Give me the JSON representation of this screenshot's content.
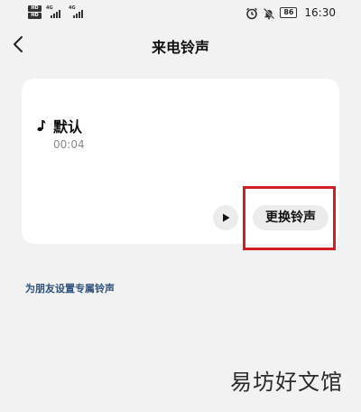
{
  "status_bar": {
    "hd_badges": [
      "HD",
      "HD"
    ],
    "network_labels": [
      "4G",
      "4G"
    ],
    "battery_level": "86",
    "time": "16:30",
    "icons": [
      "alarm-icon",
      "mute-icon"
    ]
  },
  "header": {
    "title": "来电铃声",
    "back_icon": "chevron-left-icon"
  },
  "ringtone_card": {
    "name": "默认",
    "duration": "00:04",
    "note_icon": "music-note-icon",
    "play_icon": "play-icon",
    "change_button_label": "更换铃声"
  },
  "friend_link_label": "为朋友设置专属铃声",
  "watermark": "易坊好文馆",
  "colors": {
    "background": "#f2f2f2",
    "card": "#ffffff",
    "link": "#2f5280",
    "highlight": "#d11f24"
  }
}
